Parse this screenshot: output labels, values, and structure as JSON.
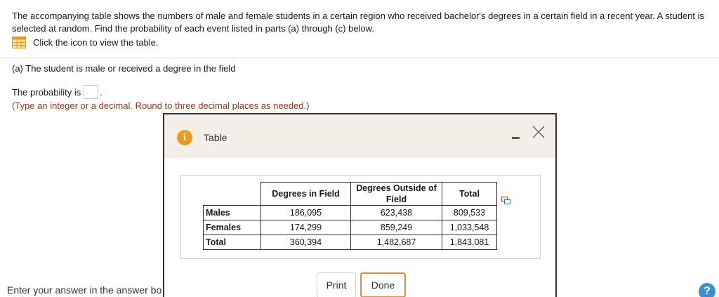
{
  "question": {
    "text": "The accompanying table shows the numbers of male and female students in a certain region who received bachelor's degrees in a certain field in a recent year. A student is selected at random. Find the probability of each event listed in parts (a) through (c) below.",
    "icon_hint": "Click the icon to view the table."
  },
  "part_a": {
    "label": "(a) The student is male or received a degree in the field",
    "prob_prefix": "The probability is",
    "prob_suffix": ".",
    "hint": "(Type an integer or a decimal. Round to three decimal places as needed.)"
  },
  "footer": {
    "enter_answer": "Enter your answer in the answer box",
    "help_label": "?"
  },
  "modal": {
    "title": "Table",
    "info_glyph": "i",
    "table": {
      "headers": [
        "",
        "Degrees in Field",
        "Degrees Outside of Field",
        "Total"
      ],
      "rows": [
        {
          "label": "Males",
          "values": [
            "186,095",
            "623,438",
            "809,533"
          ]
        },
        {
          "label": "Females",
          "values": [
            "174,299",
            "859,249",
            "1,033,548"
          ]
        },
        {
          "label": "Total",
          "values": [
            "360,394",
            "1,482,687",
            "1,843,081"
          ]
        }
      ]
    },
    "print_label": "Print",
    "done_label": "Done"
  },
  "colors": {
    "hint": "#8a3a1c",
    "info_icon": "#e89b1d",
    "done_border": "#d19341",
    "help": "#3b8fd0"
  },
  "icons": {
    "table_icon": "spreadsheet-icon",
    "info_icon": "info-icon",
    "minimize_icon": "minimize-icon",
    "close_icon": "close-icon",
    "copy_icon": "copy-icon",
    "help_icon": "help-icon"
  }
}
